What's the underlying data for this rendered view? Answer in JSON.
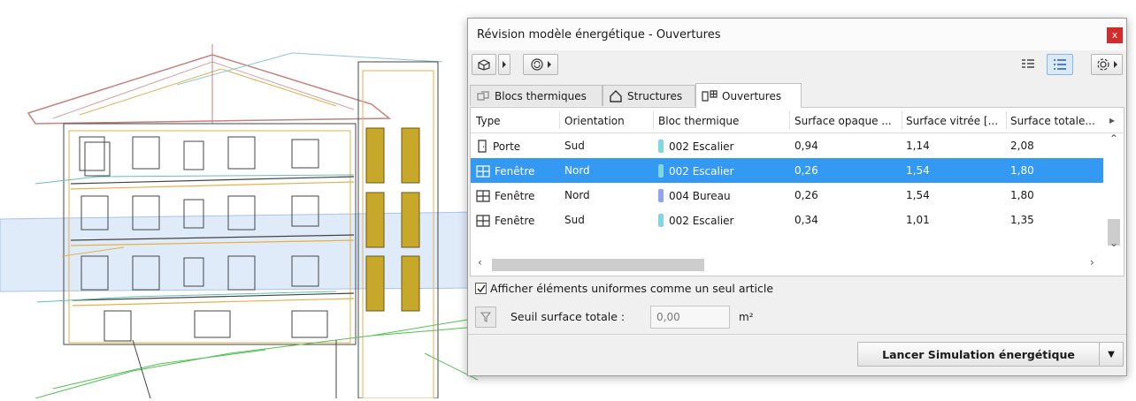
{
  "dialog": {
    "title": "Révision modèle énergétique - Ouvertures",
    "close_label": "x"
  },
  "toolbar": {
    "left_icons": [
      "3d-view-icon",
      "refresh-icon"
    ],
    "right_icons": [
      "list-view-icon",
      "detail-view-icon",
      "settings-icon"
    ]
  },
  "tabs": [
    {
      "label": "Blocs thermiques",
      "icon": "thermal-blocks-icon",
      "active": false
    },
    {
      "label": "Structures",
      "icon": "house-icon",
      "active": false
    },
    {
      "label": "Ouvertures",
      "icon": "openings-icon",
      "active": true
    }
  ],
  "table": {
    "columns": [
      "Type",
      "Orientation",
      "Bloc thermique",
      "Surface opaque ...",
      "Surface vitrée [...",
      "Surface totale..."
    ],
    "rows": [
      {
        "type": "Porte",
        "type_icon": "door-icon",
        "orientation": "Sud",
        "bloc": "002 Escalier",
        "bloc_color": "#7fd8e0",
        "opaque": "0,94",
        "vitree": "1,14",
        "totale": "2,08",
        "selected": false
      },
      {
        "type": "Fenêtre",
        "type_icon": "window-icon",
        "orientation": "Nord",
        "bloc": "002 Escalier",
        "bloc_color": "#7fd8e0",
        "opaque": "0,26",
        "vitree": "1,54",
        "totale": "1,80",
        "selected": true
      },
      {
        "type": "Fenêtre",
        "type_icon": "window-icon",
        "orientation": "Nord",
        "bloc": "004 Bureau",
        "bloc_color": "#8fa6e8",
        "opaque": "0,26",
        "vitree": "1,54",
        "totale": "1,80",
        "selected": false
      },
      {
        "type": "Fenêtre",
        "type_icon": "window-icon",
        "orientation": "Sud",
        "bloc": "002 Escalier",
        "bloc_color": "#7fd8e0",
        "opaque": "0,34",
        "vitree": "1,01",
        "totale": "1,35",
        "selected": false
      }
    ]
  },
  "options": {
    "uniform_label": "Afficher éléments uniformes comme un seul article",
    "uniform_checked": true,
    "seuil_label": "Seuil surface totale :",
    "seuil_value": "0,00",
    "seuil_unit": "m²"
  },
  "actions": {
    "launch_label": "Lancer Simulation énergétique"
  },
  "colors": {
    "selection": "#3399f3",
    "close": "#d42a2a",
    "active_view": "#dbe9f7"
  }
}
